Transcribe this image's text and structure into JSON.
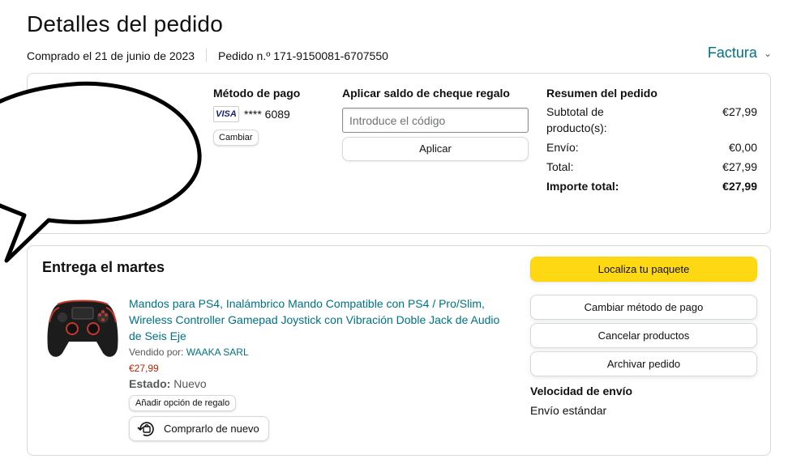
{
  "page": {
    "title": "Detalles del pedido",
    "purchased": "Comprado el 21 de junio de 2023",
    "order_number": "Pedido n.º 171-9150081-6707550",
    "invoice": "Factura"
  },
  "payment": {
    "heading": "Método de pago",
    "card_brand": "VISA",
    "card_number": "**** 6089",
    "change": "Cambiar"
  },
  "gift_card": {
    "heading": "Aplicar saldo de cheque regalo",
    "placeholder": "Introduce el código",
    "apply": "Aplicar"
  },
  "summary": {
    "heading": "Resumen del pedido",
    "rows": [
      {
        "label": "Subtotal de producto(s):",
        "value": "€27,99"
      },
      {
        "label": "Envío:",
        "value": "€0,00"
      },
      {
        "label": "Total:",
        "value": "€27,99"
      },
      {
        "label": "Importe total:",
        "value": "€27,99"
      }
    ]
  },
  "delivery": {
    "heading": "Entrega el martes",
    "product_title": "Mandos para PS4, Inalámbrico Mando Compatible con PS4 / Pro/Slim, Wireless Controller Gamepad Joystick con Vibración Doble Jack de Audio de Seis Eje",
    "sold_by_label": "Vendido por:",
    "seller": "WAAKA SARL",
    "price": "€27,99",
    "state_label": "Estado:",
    "state_value": "Nuevo",
    "gift_option": "Añadir opción de regalo",
    "rebuy": "Comprarlo de nuevo",
    "speed_heading": "Velocidad de envío",
    "speed_value": "Envío estándar"
  },
  "actions": {
    "track": "Localiza tu paquete",
    "change_payment": "Cambiar método de pago",
    "cancel": "Cancelar productos",
    "archive": "Archivar pedido"
  },
  "colors": {
    "link": "#007185",
    "price": "#b12704",
    "primary_button": "#ffd814",
    "border": "#d5d9d9"
  }
}
